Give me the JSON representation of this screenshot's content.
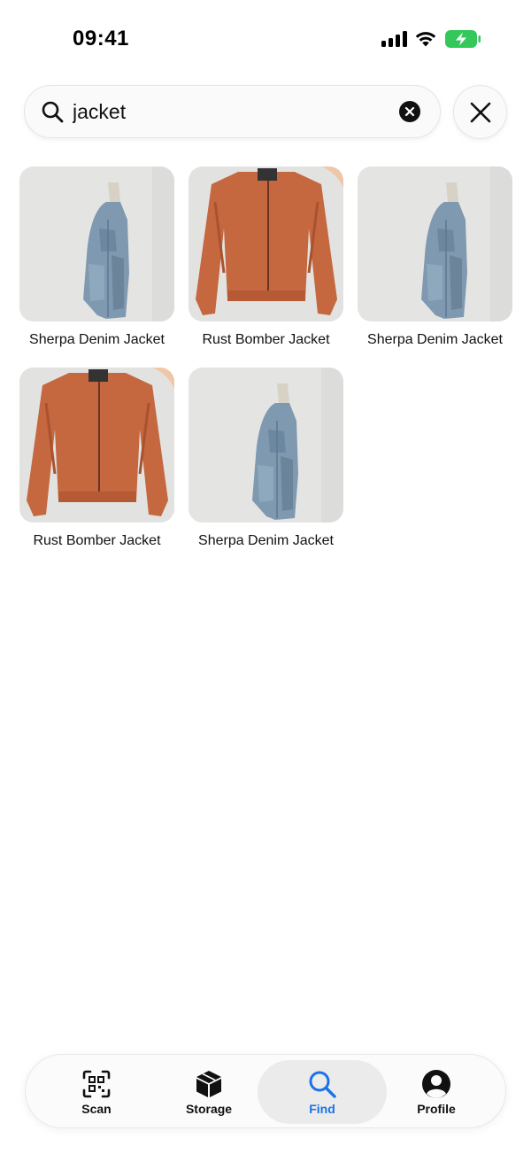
{
  "status_bar": {
    "time": "09:41",
    "icons": [
      "cellular-signal-icon",
      "wifi-icon",
      "battery-charging-icon"
    ],
    "battery_color": "#34c759"
  },
  "search": {
    "value": "jacket",
    "placeholder": "",
    "icons": {
      "search": "search-icon",
      "clear": "clear-circle-icon",
      "close": "close-icon"
    }
  },
  "results": [
    {
      "label": "Sherpa Denim Jacket",
      "image": "denim-jacket-photo"
    },
    {
      "label": "Rust Bomber Jacket",
      "image": "bomber-jacket-photo"
    },
    {
      "label": "Sherpa Denim Jacket",
      "image": "denim-jacket-photo"
    },
    {
      "label": "Rust Bomber Jacket",
      "image": "bomber-jacket-photo"
    },
    {
      "label": "Sherpa Denim Jacket",
      "image": "denim-jacket-photo"
    }
  ],
  "tab_bar": {
    "tabs": [
      {
        "label": "Scan",
        "icon": "qr-scan-icon",
        "active": false
      },
      {
        "label": "Storage",
        "icon": "box-icon",
        "active": false
      },
      {
        "label": "Find",
        "icon": "search-icon",
        "active": true
      },
      {
        "label": "Profile",
        "icon": "person-circle-icon",
        "active": false
      }
    ],
    "active_color": "#1a73e8"
  }
}
